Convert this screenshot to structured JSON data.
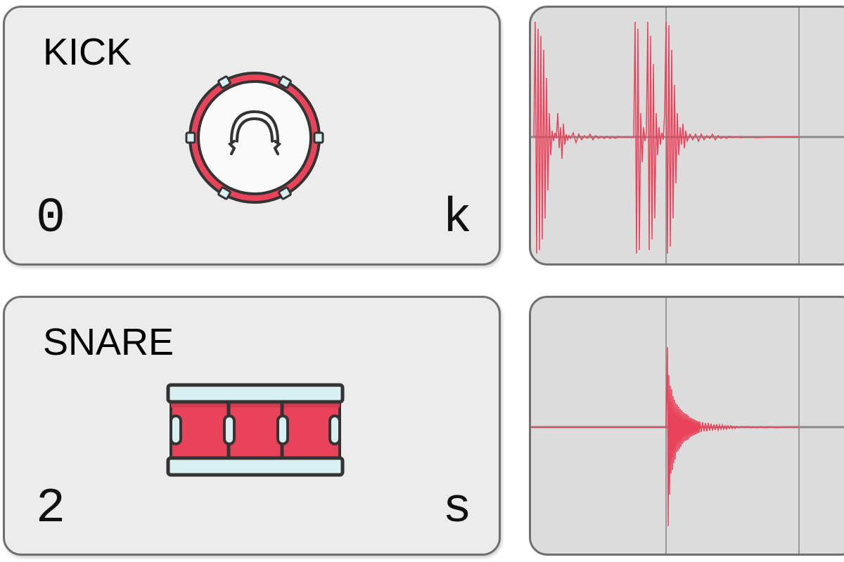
{
  "pads": [
    {
      "title": "KICK",
      "index": "0",
      "key": "k",
      "icon": "kick-drum-icon"
    },
    {
      "title": "SNARE",
      "index": "2",
      "key": "s",
      "icon": "snare-drum-icon"
    }
  ],
  "colors": {
    "accent": "#e8435a",
    "card_bg": "#ececec",
    "wave_bg": "#dcdcdc",
    "border": "#6f6f6f",
    "outline": "#333333",
    "metal": "#d9f0f2"
  }
}
